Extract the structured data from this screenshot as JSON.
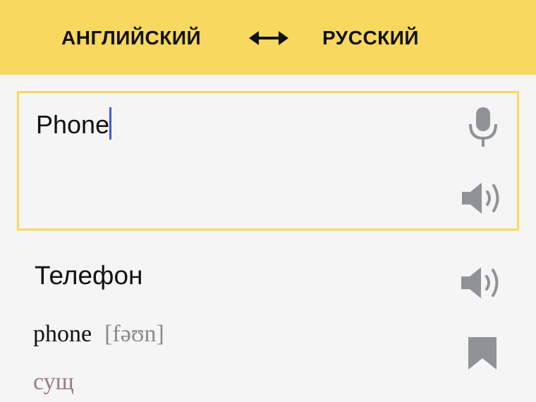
{
  "header": {
    "source_lang": "АНГЛИЙСКИЙ",
    "target_lang": "РУССКИЙ",
    "swap_icon": "swap-arrows-icon",
    "background": "#f9d85f"
  },
  "input": {
    "value": "Phone",
    "mic_icon": "microphone-icon",
    "speaker_icon": "speaker-icon",
    "border_color": "#f9d85f",
    "caret_color": "#3b5bdb"
  },
  "result": {
    "translation": "Телефон",
    "speaker_icon": "speaker-icon",
    "word": "phone",
    "transcription": "[fəʊn]",
    "part_of_speech": "сущ",
    "bookmark_icon": "bookmark-icon",
    "pos_color": "#9b7a8a"
  }
}
